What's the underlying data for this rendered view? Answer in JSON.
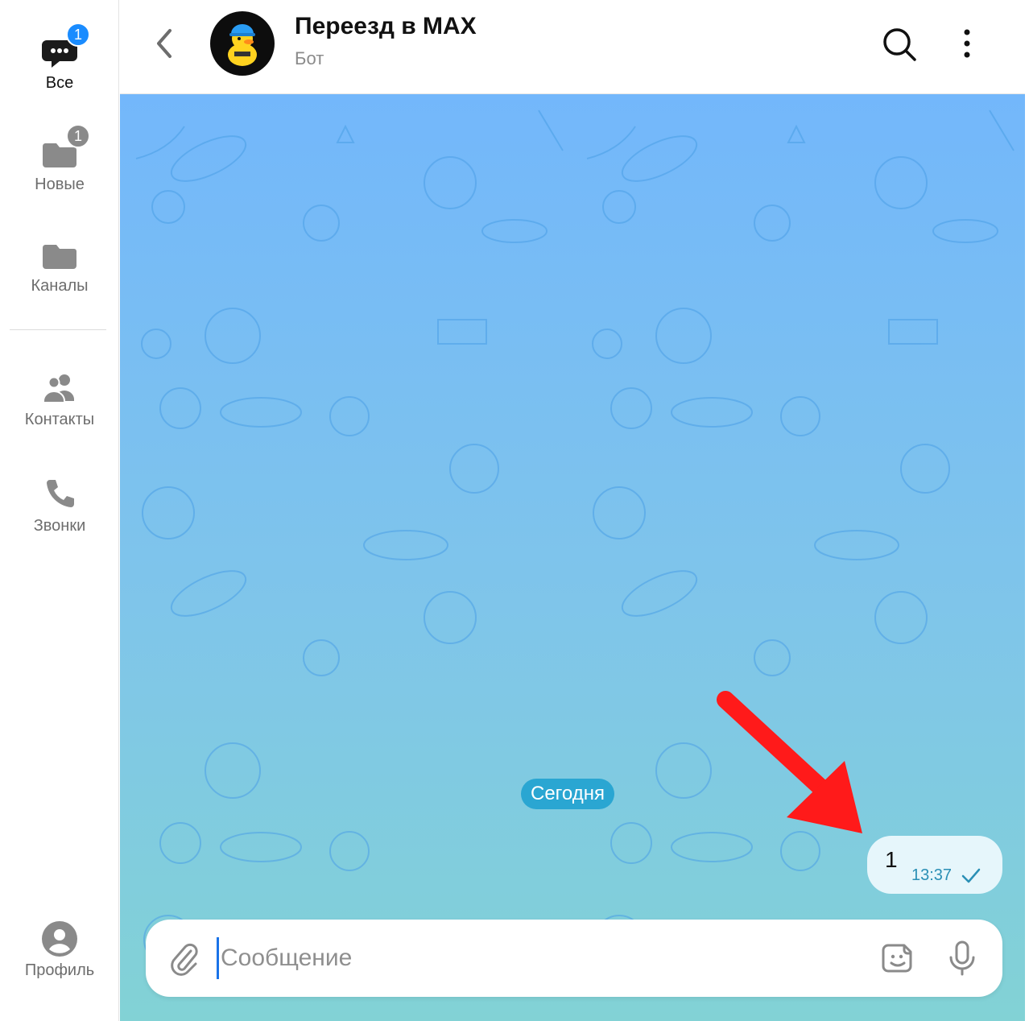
{
  "sidebar": {
    "items": [
      {
        "label": "Все",
        "badge": "1",
        "icon": "chats-icon",
        "active": true
      },
      {
        "label": "Новые",
        "badge": "1",
        "icon": "folder-icon"
      },
      {
        "label": "Каналы",
        "icon": "folder-icon"
      },
      {
        "label": "Контакты",
        "icon": "contacts-icon"
      },
      {
        "label": "Звонки",
        "icon": "phone-icon"
      },
      {
        "label": "Профиль",
        "icon": "profile-icon"
      }
    ]
  },
  "header": {
    "title": "Переезд в MAX",
    "subtitle": "Бот",
    "avatar_icon": "duck-avatar-icon",
    "back_icon": "chevron-left-icon",
    "search_icon": "search-icon",
    "menu_icon": "more-vertical-icon"
  },
  "chat": {
    "date_separator": "Сегодня",
    "messages": [
      {
        "text": "1",
        "time": "13:37",
        "status_icon": "check-icon",
        "outgoing": true
      }
    ],
    "annotation_icon": "red-arrow-icon"
  },
  "composer": {
    "placeholder": "Сообщение",
    "value": "",
    "attach_icon": "paperclip-icon",
    "sticker_icon": "sticker-icon",
    "mic_icon": "microphone-icon"
  },
  "colors": {
    "accent": "#1a8cff",
    "chat_top": "#73b7fb",
    "chat_bottom": "#82d2d5",
    "date_pill": "#2aa6d2",
    "bubble": "#e6f6fb",
    "arrow": "#ff1a1a"
  }
}
